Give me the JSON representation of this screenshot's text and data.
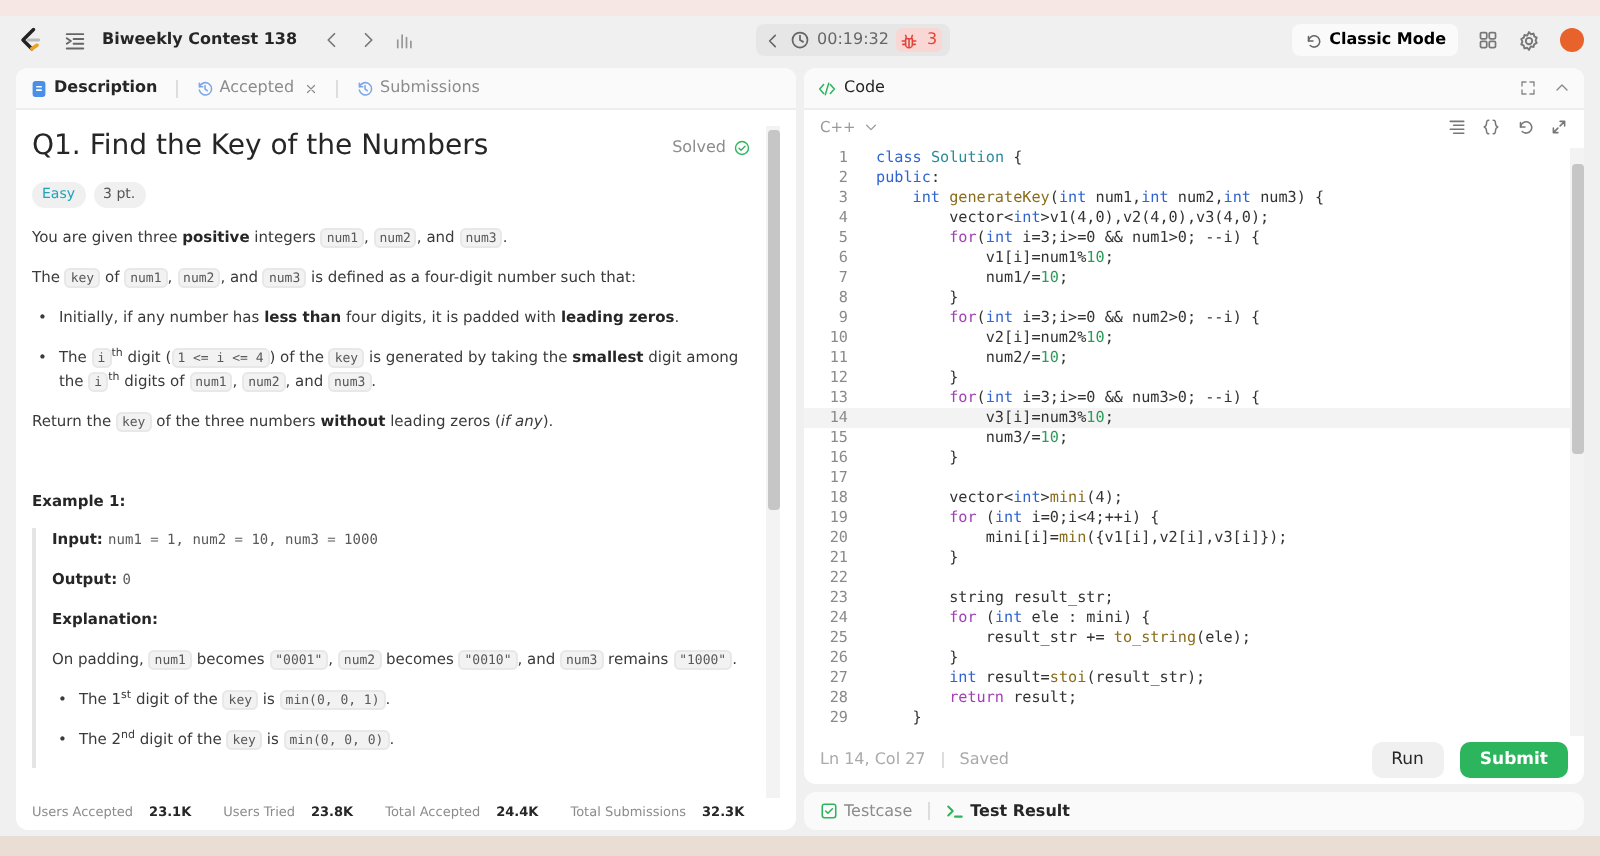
{
  "topbar": {
    "title": "Biweekly Contest 138",
    "timer": "00:19:32",
    "bug_count": "3",
    "mode_button": "Classic Mode"
  },
  "left_tabs": [
    {
      "label": "Description",
      "selected": true,
      "closable": false
    },
    {
      "label": "Accepted",
      "selected": false,
      "closable": true
    },
    {
      "label": "Submissions",
      "selected": false,
      "closable": false
    }
  ],
  "problem": {
    "title": "Q1. Find the Key of the Numbers",
    "status": "Solved",
    "difficulty": "Easy",
    "points": "3 pt.",
    "body": [
      {
        "kind": "p",
        "segs": [
          {
            "kind": "text",
            "text": "You are given three "
          },
          {
            "kind": "bold",
            "text": "positive"
          },
          {
            "kind": "text",
            "text": " integers "
          },
          {
            "kind": "code",
            "text": "num1"
          },
          {
            "kind": "text",
            "text": ", "
          },
          {
            "kind": "code",
            "text": "num2"
          },
          {
            "kind": "text",
            "text": ", and "
          },
          {
            "kind": "code",
            "text": "num3"
          },
          {
            "kind": "text",
            "text": "."
          }
        ]
      },
      {
        "kind": "p",
        "segs": [
          {
            "kind": "text",
            "text": "The "
          },
          {
            "kind": "code",
            "text": "key"
          },
          {
            "kind": "text",
            "text": " of "
          },
          {
            "kind": "code",
            "text": "num1"
          },
          {
            "kind": "text",
            "text": ", "
          },
          {
            "kind": "code",
            "text": "num2"
          },
          {
            "kind": "text",
            "text": ", and "
          },
          {
            "kind": "code",
            "text": "num3"
          },
          {
            "kind": "text",
            "text": " is defined as a four-digit number such that:"
          }
        ]
      },
      {
        "kind": "li",
        "marker": "•",
        "segs": [
          {
            "kind": "text",
            "text": "Initially, if any number has "
          },
          {
            "kind": "bold",
            "text": "less than"
          },
          {
            "kind": "text",
            "text": " four digits, it is padded with "
          },
          {
            "kind": "bold",
            "text": "leading zeros"
          },
          {
            "kind": "text",
            "text": "."
          }
        ]
      },
      {
        "kind": "li",
        "marker": "•",
        "segs": [
          {
            "kind": "text",
            "text": "The "
          },
          {
            "kind": "code",
            "text": "i"
          },
          {
            "kind": "sup",
            "text": "th"
          },
          {
            "kind": "text",
            "text": " digit ("
          },
          {
            "kind": "code",
            "text": "1 <= i <= 4"
          },
          {
            "kind": "text",
            "text": ") of the "
          },
          {
            "kind": "code",
            "text": "key"
          },
          {
            "kind": "text",
            "text": " is generated by taking the "
          },
          {
            "kind": "bold",
            "text": "smallest"
          },
          {
            "kind": "text",
            "text": " digit among the "
          },
          {
            "kind": "code",
            "text": "i"
          },
          {
            "kind": "sup",
            "text": "th"
          },
          {
            "kind": "text",
            "text": " digits of "
          },
          {
            "kind": "code",
            "text": "num1"
          },
          {
            "kind": "text",
            "text": ", "
          },
          {
            "kind": "code",
            "text": "num2"
          },
          {
            "kind": "text",
            "text": ", and "
          },
          {
            "kind": "code",
            "text": "num3"
          },
          {
            "kind": "text",
            "text": "."
          }
        ]
      },
      {
        "kind": "p",
        "segs": [
          {
            "kind": "text",
            "text": "Return the "
          },
          {
            "kind": "code",
            "text": "key"
          },
          {
            "kind": "text",
            "text": " of the three numbers "
          },
          {
            "kind": "bold",
            "text": "without"
          },
          {
            "kind": "text",
            "text": " leading zeros ("
          },
          {
            "kind": "italic",
            "text": "if any"
          },
          {
            "kind": "text",
            "text": ")."
          }
        ]
      }
    ],
    "example_title": "Example 1:",
    "example": [
      {
        "kind": "p",
        "segs": [
          {
            "kind": "bold",
            "text": "Input: "
          },
          {
            "kind": "mono",
            "text": "num1 = 1, num2 = 10, num3 = 1000"
          }
        ]
      },
      {
        "kind": "p",
        "segs": [
          {
            "kind": "bold",
            "text": "Output: "
          },
          {
            "kind": "mono",
            "text": "0"
          }
        ]
      },
      {
        "kind": "p",
        "segs": [
          {
            "kind": "bold",
            "text": "Explanation:"
          }
        ]
      },
      {
        "kind": "p",
        "segs": [
          {
            "kind": "text",
            "text": "On padding, "
          },
          {
            "kind": "code",
            "text": "num1"
          },
          {
            "kind": "text",
            "text": " becomes "
          },
          {
            "kind": "code",
            "text": "\"0001\""
          },
          {
            "kind": "text",
            "text": ", "
          },
          {
            "kind": "code",
            "text": "num2"
          },
          {
            "kind": "text",
            "text": " becomes "
          },
          {
            "kind": "code",
            "text": "\"0010\""
          },
          {
            "kind": "text",
            "text": ", and "
          },
          {
            "kind": "code",
            "text": "num3"
          },
          {
            "kind": "text",
            "text": " remains "
          },
          {
            "kind": "code",
            "text": "\"1000\""
          },
          {
            "kind": "text",
            "text": "."
          }
        ]
      },
      {
        "kind": "li",
        "marker": "•",
        "segs": [
          {
            "kind": "text",
            "text": "The 1"
          },
          {
            "kind": "sup",
            "text": "st"
          },
          {
            "kind": "text",
            "text": " digit of the "
          },
          {
            "kind": "code",
            "text": "key"
          },
          {
            "kind": "text",
            "text": " is "
          },
          {
            "kind": "code",
            "text": "min(0, 0, 1)"
          },
          {
            "kind": "text",
            "text": "."
          }
        ]
      },
      {
        "kind": "li",
        "marker": "•",
        "segs": [
          {
            "kind": "text",
            "text": "The 2"
          },
          {
            "kind": "sup",
            "text": "nd"
          },
          {
            "kind": "text",
            "text": " digit of the "
          },
          {
            "kind": "code",
            "text": "key"
          },
          {
            "kind": "text",
            "text": " is "
          },
          {
            "kind": "code",
            "text": "min(0, 0, 0)"
          },
          {
            "kind": "text",
            "text": "."
          }
        ]
      }
    ]
  },
  "stats": [
    {
      "label": "Users Accepted",
      "value": "23.1K"
    },
    {
      "label": "Users Tried",
      "value": "23.8K"
    },
    {
      "label": "Total Accepted",
      "value": "24.4K"
    },
    {
      "label": "Total Submissions",
      "value": "32.3K"
    }
  ],
  "code_panel": {
    "title": "Code",
    "language": "C++",
    "cursor": "Ln 14, Col 27",
    "save_state": "Saved",
    "run": "Run",
    "submit": "Submit"
  },
  "code_lines": [
    {
      "n": "1",
      "active": false,
      "segs": [
        {
          "kind": "keyword",
          "text": "class "
        },
        {
          "kind": "type",
          "text": "Solution"
        },
        {
          "kind": "plain",
          "text": " {"
        }
      ]
    },
    {
      "n": "2",
      "active": false,
      "segs": [
        {
          "kind": "keyword",
          "text": "public"
        },
        {
          "kind": "plain",
          "text": ":"
        }
      ]
    },
    {
      "n": "3",
      "active": false,
      "segs": [
        {
          "kind": "keyword",
          "text": "    int "
        },
        {
          "kind": "function",
          "text": "generateKey"
        },
        {
          "kind": "plain",
          "text": "("
        },
        {
          "kind": "keyword",
          "text": "int "
        },
        {
          "kind": "plain",
          "text": "num1,"
        },
        {
          "kind": "keyword",
          "text": "int "
        },
        {
          "kind": "plain",
          "text": "num2,"
        },
        {
          "kind": "keyword",
          "text": "int "
        },
        {
          "kind": "plain",
          "text": "num3) {"
        }
      ]
    },
    {
      "n": "4",
      "active": false,
      "segs": [
        {
          "kind": "plain",
          "text": "        vector<"
        },
        {
          "kind": "keyword",
          "text": "int"
        },
        {
          "kind": "plain",
          "text": ">v1(4,0),v2(4,0),v3(4,0);"
        }
      ]
    },
    {
      "n": "5",
      "active": false,
      "segs": [
        {
          "kind": "control",
          "text": "        for"
        },
        {
          "kind": "plain",
          "text": "("
        },
        {
          "kind": "keyword",
          "text": "int "
        },
        {
          "kind": "plain",
          "text": "i=3;i>=0 && num1>0; --i) {"
        }
      ]
    },
    {
      "n": "6",
      "active": false,
      "segs": [
        {
          "kind": "plain",
          "text": "            v1[i]=num1%"
        },
        {
          "kind": "number",
          "text": "10"
        },
        {
          "kind": "plain",
          "text": ";"
        }
      ]
    },
    {
      "n": "7",
      "active": false,
      "segs": [
        {
          "kind": "plain",
          "text": "            num1/="
        },
        {
          "kind": "number",
          "text": "10"
        },
        {
          "kind": "plain",
          "text": ";"
        }
      ]
    },
    {
      "n": "8",
      "active": false,
      "segs": [
        {
          "kind": "plain",
          "text": "        }"
        }
      ]
    },
    {
      "n": "9",
      "active": false,
      "segs": [
        {
          "kind": "control",
          "text": "        for"
        },
        {
          "kind": "plain",
          "text": "("
        },
        {
          "kind": "keyword",
          "text": "int "
        },
        {
          "kind": "plain",
          "text": "i=3;i>=0 && num2>0; --i) {"
        }
      ]
    },
    {
      "n": "10",
      "active": false,
      "segs": [
        {
          "kind": "plain",
          "text": "            v2[i]=num2%"
        },
        {
          "kind": "number",
          "text": "10"
        },
        {
          "kind": "plain",
          "text": ";"
        }
      ]
    },
    {
      "n": "11",
      "active": false,
      "segs": [
        {
          "kind": "plain",
          "text": "            num2/="
        },
        {
          "kind": "number",
          "text": "10"
        },
        {
          "kind": "plain",
          "text": ";"
        }
      ]
    },
    {
      "n": "12",
      "active": false,
      "segs": [
        {
          "kind": "plain",
          "text": "        }"
        }
      ]
    },
    {
      "n": "13",
      "active": false,
      "segs": [
        {
          "kind": "control",
          "text": "        for"
        },
        {
          "kind": "plain",
          "text": "("
        },
        {
          "kind": "keyword",
          "text": "int "
        },
        {
          "kind": "plain",
          "text": "i=3;i>=0 && num3>0; --i) {"
        }
      ]
    },
    {
      "n": "14",
      "active": true,
      "segs": [
        {
          "kind": "plain",
          "text": "            v3[i]=num3%"
        },
        {
          "kind": "number",
          "text": "10"
        },
        {
          "kind": "plain",
          "text": ";"
        }
      ]
    },
    {
      "n": "15",
      "active": false,
      "segs": [
        {
          "kind": "plain",
          "text": "            num3/="
        },
        {
          "kind": "number",
          "text": "10"
        },
        {
          "kind": "plain",
          "text": ";"
        }
      ]
    },
    {
      "n": "16",
      "active": false,
      "segs": [
        {
          "kind": "plain",
          "text": "        }"
        }
      ]
    },
    {
      "n": "17",
      "active": false
    },
    {
      "n": "18",
      "active": false,
      "segs": [
        {
          "kind": "plain",
          "text": "        vector<"
        },
        {
          "kind": "keyword",
          "text": "int"
        },
        {
          "kind": "plain",
          "text": ">"
        },
        {
          "kind": "function",
          "text": "mini"
        },
        {
          "kind": "plain",
          "text": "(4);"
        }
      ]
    },
    {
      "n": "19",
      "active": false,
      "segs": [
        {
          "kind": "control",
          "text": "        for"
        },
        {
          "kind": "plain",
          "text": " ("
        },
        {
          "kind": "keyword",
          "text": "int "
        },
        {
          "kind": "plain",
          "text": "i=0;i<4;++i) {"
        }
      ]
    },
    {
      "n": "20",
      "active": false,
      "segs": [
        {
          "kind": "plain",
          "text": "            mini[i]="
        },
        {
          "kind": "function",
          "text": "min"
        },
        {
          "kind": "plain",
          "text": "({v1[i],v2[i],v3[i]});"
        }
      ]
    },
    {
      "n": "21",
      "active": false,
      "segs": [
        {
          "kind": "plain",
          "text": "        }"
        }
      ]
    },
    {
      "n": "22",
      "active": false
    },
    {
      "n": "23",
      "active": false,
      "segs": [
        {
          "kind": "plain",
          "text": "        string result_str;"
        }
      ]
    },
    {
      "n": "24",
      "active": false,
      "segs": [
        {
          "kind": "control",
          "text": "        for"
        },
        {
          "kind": "plain",
          "text": " ("
        },
        {
          "kind": "keyword",
          "text": "int "
        },
        {
          "kind": "plain",
          "text": "ele : mini) {"
        }
      ]
    },
    {
      "n": "25",
      "active": false,
      "segs": [
        {
          "kind": "plain",
          "text": "            result_str += "
        },
        {
          "kind": "function",
          "text": "to_string"
        },
        {
          "kind": "plain",
          "text": "(ele);"
        }
      ]
    },
    {
      "n": "26",
      "active": false,
      "segs": [
        {
          "kind": "plain",
          "text": "        }"
        }
      ]
    },
    {
      "n": "27",
      "active": false,
      "segs": [
        {
          "kind": "keyword",
          "text": "        int "
        },
        {
          "kind": "plain",
          "text": "result="
        },
        {
          "kind": "function",
          "text": "stoi"
        },
        {
          "kind": "plain",
          "text": "(result_str);"
        }
      ]
    },
    {
      "n": "28",
      "active": false,
      "segs": [
        {
          "kind": "control",
          "text": "        return "
        },
        {
          "kind": "plain",
          "text": "result;"
        }
      ]
    },
    {
      "n": "29",
      "active": false,
      "segs": [
        {
          "kind": "plain",
          "text": "    }"
        }
      ]
    }
  ],
  "bottom_tabs": [
    {
      "label": "Testcase",
      "selected": false
    },
    {
      "label": "Test Result",
      "selected": true
    }
  ]
}
